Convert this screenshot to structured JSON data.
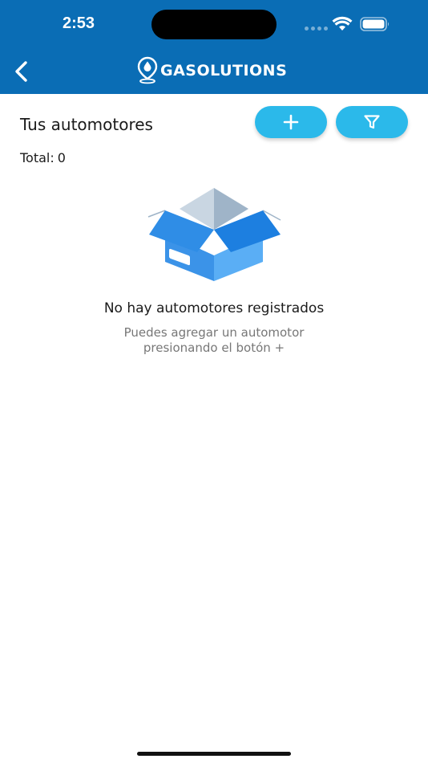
{
  "status_bar": {
    "time": "2:53",
    "wifi_icon": "wifi-icon",
    "battery_icon": "battery-icon"
  },
  "nav": {
    "back_icon": "chevron-left-icon",
    "logo_text": "GASOLUTIONS",
    "bar_color": "#0a6db5"
  },
  "header": {
    "title": "Tus automotores",
    "add_icon": "plus-icon",
    "filter_icon": "filter-icon",
    "button_color": "#2bb9ea"
  },
  "summary": {
    "total_label": "Total:",
    "total_value": "0"
  },
  "empty_state": {
    "icon": "empty-box-icon",
    "title": "No hay automotores registrados",
    "hint": "Puedes agregar un automotor presionando el botón +"
  }
}
